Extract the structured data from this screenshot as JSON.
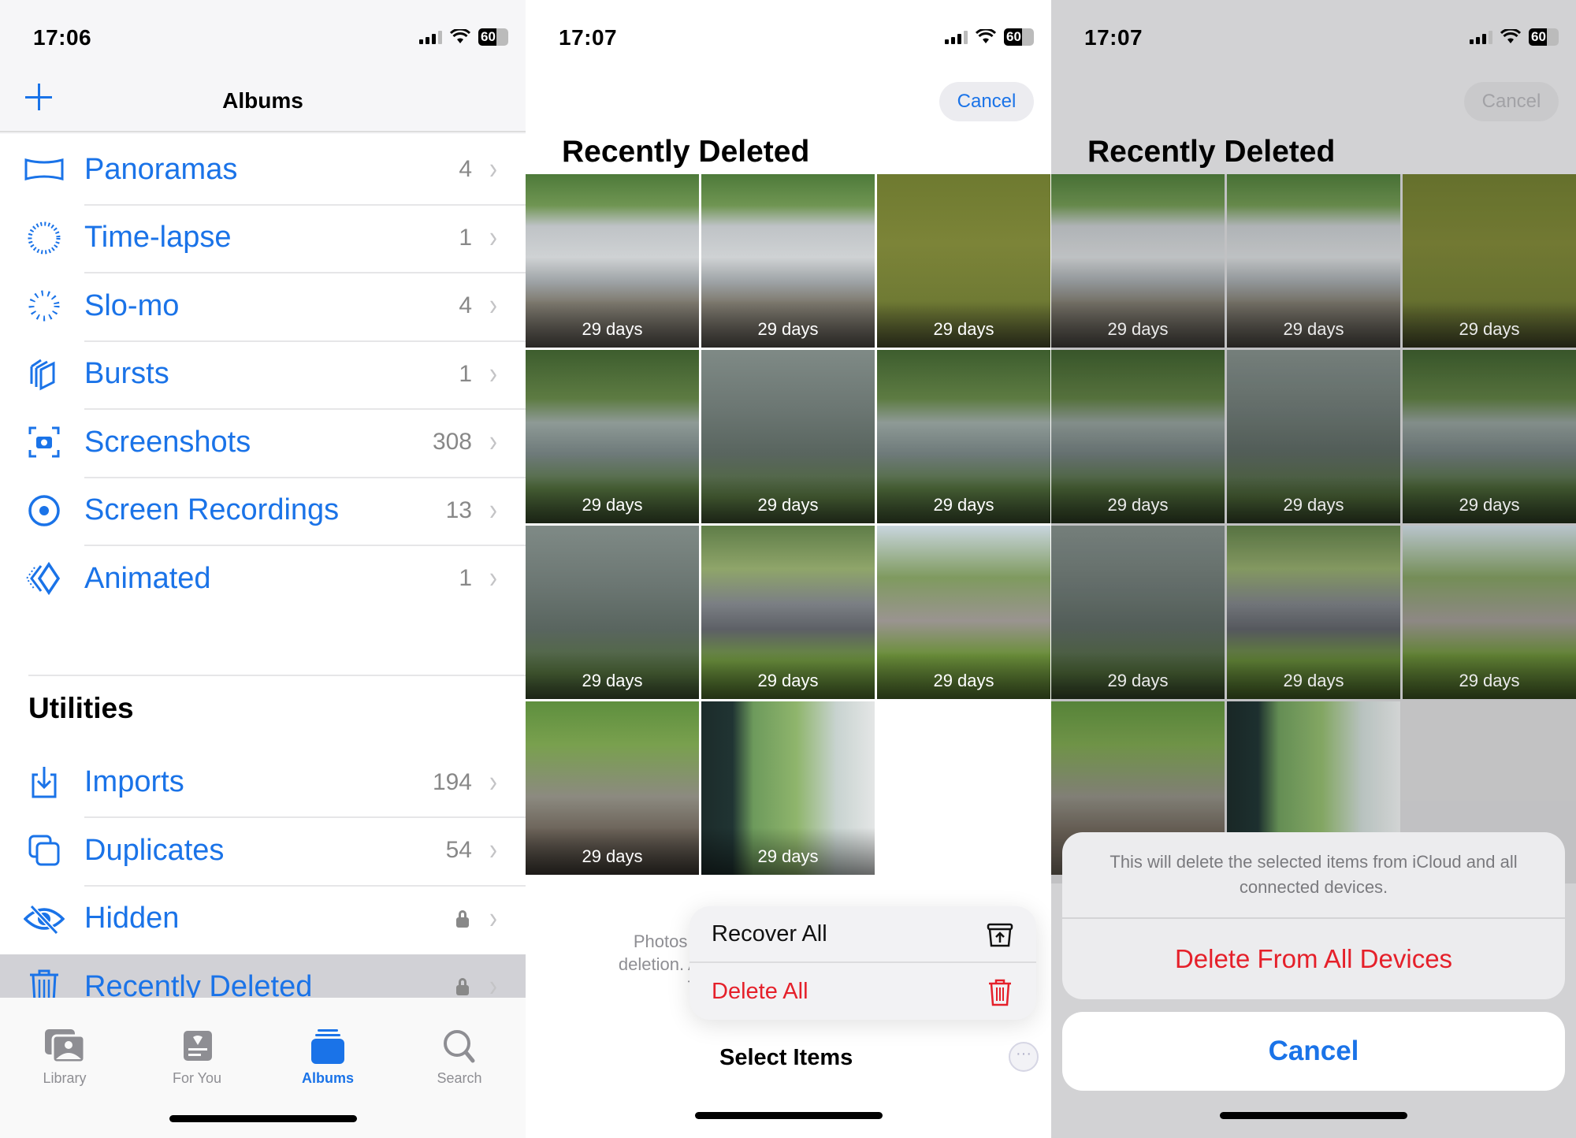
{
  "panels": [
    {
      "status": {
        "time": "17:06",
        "battery": "60"
      },
      "navbar": {
        "title": "Albums"
      },
      "media_types": [
        {
          "icon": "panorama-icon",
          "label": "Panoramas",
          "count": "4"
        },
        {
          "icon": "timelapse-icon",
          "label": "Time-lapse",
          "count": "1"
        },
        {
          "icon": "slomo-icon",
          "label": "Slo-mo",
          "count": "4"
        },
        {
          "icon": "bursts-icon",
          "label": "Bursts",
          "count": "1"
        },
        {
          "icon": "screenshot-icon",
          "label": "Screenshots",
          "count": "308"
        },
        {
          "icon": "screen-recording-icon",
          "label": "Screen Recordings",
          "count": "13"
        },
        {
          "icon": "animated-icon",
          "label": "Animated",
          "count": "1"
        }
      ],
      "utilities": {
        "heading": "Utilities",
        "items": [
          {
            "icon": "import-icon",
            "label": "Imports",
            "count": "194",
            "locked": false
          },
          {
            "icon": "duplicates-icon",
            "label": "Duplicates",
            "count": "54",
            "locked": false
          },
          {
            "icon": "hidden-eye-icon",
            "label": "Hidden",
            "count": "",
            "locked": true
          },
          {
            "icon": "trash-icon",
            "label": "Recently Deleted",
            "count": "",
            "locked": true,
            "selected": true
          }
        ]
      },
      "tabbar": [
        {
          "icon": "library-icon",
          "label": "Library"
        },
        {
          "icon": "for-you-icon",
          "label": "For You"
        },
        {
          "icon": "albums-icon",
          "label": "Albums",
          "active": true
        },
        {
          "icon": "search-icon",
          "label": "Search"
        }
      ]
    },
    {
      "status": {
        "time": "17:07",
        "battery": "60"
      },
      "cancel_label": "Cancel",
      "title": "Recently Deleted",
      "photos": [
        {
          "scene": "car",
          "days": "29 days"
        },
        {
          "scene": "car",
          "days": "29 days"
        },
        {
          "scene": "pond-green",
          "days": "29 days"
        },
        {
          "scene": "pond",
          "days": "29 days"
        },
        {
          "scene": "water",
          "days": "29 days"
        },
        {
          "scene": "pond",
          "days": "29 days"
        },
        {
          "scene": "water",
          "days": "29 days"
        },
        {
          "scene": "street",
          "days": "29 days"
        },
        {
          "scene": "path",
          "days": "29 days"
        },
        {
          "scene": "park",
          "days": "29 days"
        },
        {
          "scene": "window",
          "days": "29 days"
        }
      ],
      "footer_text_lines": [
        "Photos and vi",
        "deletion. After tha",
        "Th"
      ],
      "menu": {
        "recover_all": "Recover All",
        "delete_all": "Delete All"
      },
      "select_items": "Select Items",
      "more_glyph": "···"
    },
    {
      "status": {
        "time": "17:07",
        "battery": "60"
      },
      "cancel_label": "Cancel",
      "title": "Recently Deleted",
      "photos": [
        {
          "scene": "car",
          "days": "29 days"
        },
        {
          "scene": "car",
          "days": "29 days"
        },
        {
          "scene": "pond-green",
          "days": "29 days"
        },
        {
          "scene": "pond",
          "days": "29 days"
        },
        {
          "scene": "water",
          "days": "29 days"
        },
        {
          "scene": "pond",
          "days": "29 days"
        },
        {
          "scene": "water",
          "days": "29 days"
        },
        {
          "scene": "street",
          "days": "29 days"
        },
        {
          "scene": "path",
          "days": "29 days"
        },
        {
          "scene": "park",
          "days": ""
        },
        {
          "scene": "window",
          "days": ""
        }
      ],
      "action_sheet": {
        "message": "This will delete the selected items from iCloud and all connected devices.",
        "destructive_label": "Delete From All Devices",
        "cancel_label": "Cancel"
      }
    }
  ],
  "colors": {
    "accent_blue": "#1a73e8",
    "destructive_red": "#e5202a",
    "secondary_gray": "#8e8e93"
  }
}
